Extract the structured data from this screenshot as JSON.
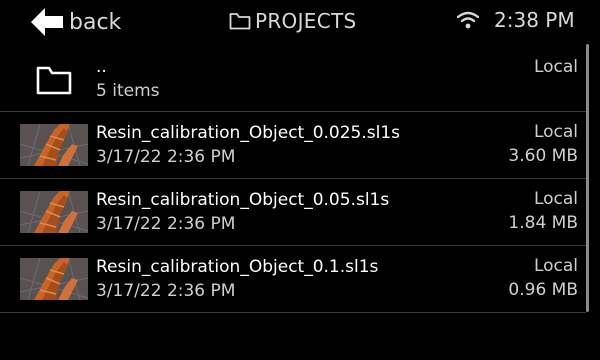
{
  "header": {
    "back_label": "back",
    "title": "PROJECTS",
    "time": "2:38 PM"
  },
  "parent": {
    "name": "..",
    "count": "5 items",
    "location": "Local"
  },
  "files": [
    {
      "name": "Resin_calibration_Object_0.025.sl1s",
      "date": "3/17/22 2:36 PM",
      "location": "Local",
      "size": "3.60 MB"
    },
    {
      "name": "Resin_calibration_Object_0.05.sl1s",
      "date": "3/17/22 2:36 PM",
      "location": "Local",
      "size": "1.84 MB"
    },
    {
      "name": "Resin_calibration_Object_0.1.sl1s",
      "date": "3/17/22 2:36 PM",
      "location": "Local",
      "size": "0.96 MB"
    }
  ],
  "icons": {
    "back": "arrow-left-icon",
    "title": "folder-icon",
    "status": "wifi-icon",
    "thumbnail": "model-thumbnail"
  },
  "colors": {
    "background": "#000000",
    "text": "#ffffff",
    "muted": "#cfcfcf",
    "divider": "#3a3a3a",
    "model": "#c8642a"
  }
}
